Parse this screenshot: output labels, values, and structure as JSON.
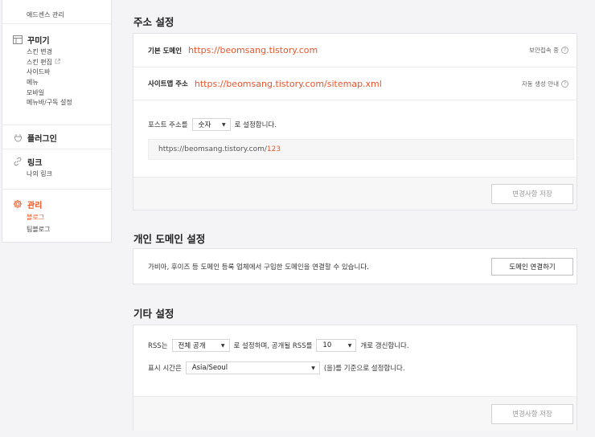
{
  "sidebar": {
    "top_item": "애드센스 관리",
    "groups": [
      {
        "title": "꾸미기",
        "icon": "layout-icon",
        "items": [
          "스킨 변경",
          "스킨 편집",
          "사이드바",
          "메뉴",
          "모바일",
          "메뉴바/구독 설정"
        ]
      },
      {
        "title": "플러그인",
        "icon": "plugin-icon",
        "items": []
      },
      {
        "title": "링크",
        "icon": "link-icon",
        "items": [
          "나의 링크"
        ]
      },
      {
        "title": "관리",
        "icon": "gear-icon",
        "items": [
          "블로그",
          "팀블로그"
        ]
      }
    ]
  },
  "address": {
    "title": "주소 설정",
    "base_domain_label": "기본 도메인",
    "base_domain_url": "https://beomsang.tistory.com",
    "secure_label": "보안접속 중",
    "sitemap_label": "사이트맵 주소",
    "sitemap_url": "https://beomsang.tistory.com/sitemap.xml",
    "auto_label": "자동 생성 안내",
    "post_addr_prefix": "포스트 주소를",
    "post_addr_value": "숫자",
    "post_addr_suffix": "로 설정합니다.",
    "preview_base": "https://beomsang.tistory.com/",
    "preview_num": "123",
    "save_label": "변경사항 저장"
  },
  "domain": {
    "title": "개인 도메인 설정",
    "desc": "가비아, 후이즈 등 도메인 등록 업체에서 구입한 도메인을 연결할 수 있습니다.",
    "connect_label": "도메인 연결하기"
  },
  "etc": {
    "title": "기타 설정",
    "rss_prefix": "RSS는",
    "rss_public_value": "전체 공개",
    "rss_middle": "로 설정하며, 공개될 RSS를",
    "rss_count_value": "10",
    "rss_suffix": "개로 갱신합니다.",
    "tz_prefix": "표시 시간은",
    "tz_value": "Asia/Seoul",
    "tz_suffix": "(을)를 기준으로 설정합니다.",
    "save_label": "변경사항 저장"
  },
  "colors": {
    "accent": "#eb531f",
    "url": "#e8532a"
  }
}
